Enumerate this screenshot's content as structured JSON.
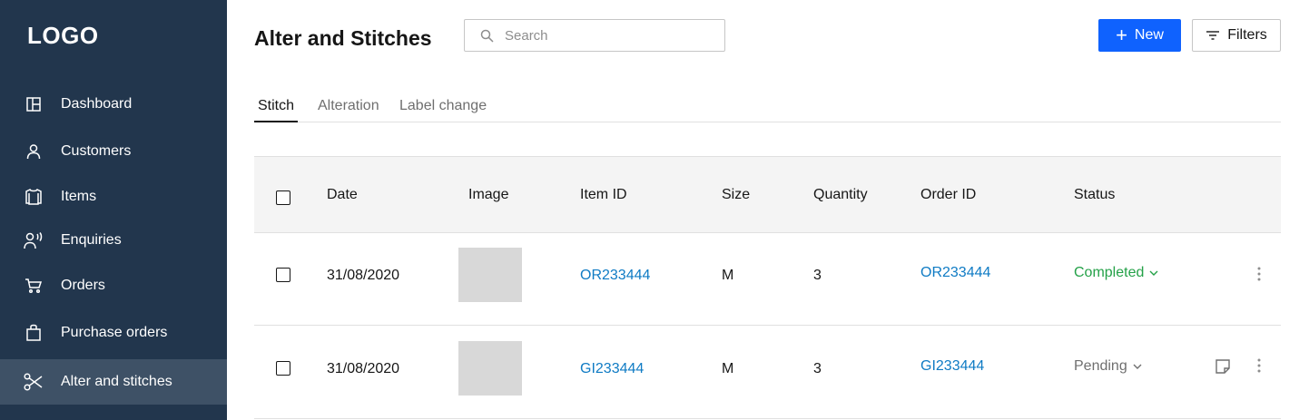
{
  "sidebar": {
    "logo": "LOGO",
    "items": [
      {
        "label": "Dashboard",
        "icon": "dashboard-icon"
      },
      {
        "label": "Customers",
        "icon": "user-icon"
      },
      {
        "label": "Items",
        "icon": "shirt-icon"
      },
      {
        "label": "Enquiries",
        "icon": "enquiry-icon"
      },
      {
        "label": "Orders",
        "icon": "cart-icon"
      },
      {
        "label": "Purchase orders",
        "icon": "bag-icon"
      },
      {
        "label": "Alter and stitches",
        "icon": "scissors-icon",
        "active": true
      }
    ]
  },
  "header": {
    "title": "Alter and Stitches",
    "search_placeholder": "Search",
    "new_label": "New",
    "filters_label": "Filters"
  },
  "tabs": [
    {
      "label": "Stitch",
      "active": true
    },
    {
      "label": "Alteration"
    },
    {
      "label": "Label change"
    }
  ],
  "table": {
    "columns": [
      "Date",
      "Image",
      "Item ID",
      "Size",
      "Quantity",
      "Order ID",
      "Status"
    ],
    "rows": [
      {
        "date": "31/08/2020",
        "item_id": "OR233444",
        "size": "M",
        "quantity": "3",
        "order_id": "OR233444",
        "status": "Completed",
        "status_color": "#24a148",
        "has_note": false
      },
      {
        "date": "31/08/2020",
        "item_id": "GI233444",
        "size": "M",
        "quantity": "3",
        "order_id": "GI233444",
        "status": "Pending",
        "status_color": "#6f6f6f",
        "has_note": true
      }
    ]
  },
  "colors": {
    "sidebar_bg": "#22364d",
    "sidebar_active": "#3e5166",
    "primary": "#0f62fe",
    "link": "#0f7bc4"
  }
}
